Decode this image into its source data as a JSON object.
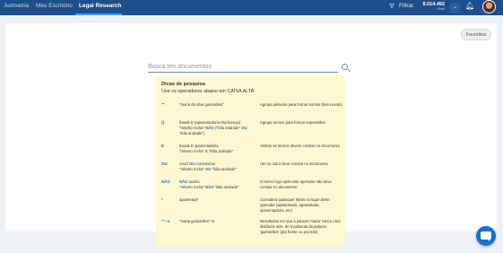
{
  "nav": {
    "items": [
      {
        "label": "Jurimetria"
      },
      {
        "label": "Meu Escritório"
      },
      {
        "label": "Legal Research"
      }
    ],
    "active_index": 2,
    "filter_label": "Filtrar",
    "credits": {
      "value": "8.014.492",
      "label": "Crwd"
    }
  },
  "favorites_label": "Favoritos",
  "search": {
    "placeholder": "Busca em documentos"
  },
  "tips": {
    "title": "Dicas de pesquisa",
    "subtitle": "Use os operadores abaixo em CAIXA ALTA:",
    "rows": [
      {
        "op": "\"\"",
        "example_lines": [
          [
            "\"maria da silva guimarães\""
          ]
        ],
        "desc": "Agrupa palavras para formar termos (texto exato)"
      },
      {
        "op": "()",
        "example_lines": [
          [
            "fraude E (aposentadoria ",
            {
              "hl": "OU"
            },
            " licença)"
          ],
          [
            "\"roberto rocha\" ",
            {
              "hl": "NÃO"
            },
            " (\"lídia andrade\" ",
            {
              "hl": "OU"
            }
          ],
          [
            "\"lidia andrade\")"
          ]
        ],
        "desc": "Agrupa termos para formar expressões"
      },
      {
        "op": "E",
        "example_lines": [
          [
            "fraude E aposentadoria"
          ],
          [
            "\"roberto rocha\" E \"lídia andrade\""
          ]
        ],
        "desc": "Ambos os termos devem constar no documento"
      },
      {
        "op": "OU",
        "example_lines": [
          [
            "covid ",
            {
              "hl": "OU"
            },
            " coronavírus"
          ],
          [
            "\"roberto rocha\" ",
            {
              "hl": "OU"
            },
            " \"lídia andrade\""
          ]
        ],
        "desc": "Um ou outro deve constar no documento"
      },
      {
        "op": "NÃO",
        "example_lines": [
          [
            "",
            {
              "hl": "NÃO"
            },
            " auxílio"
          ],
          [
            "\"roberto rocha\" ",
            {
              "hl": "NÃO"
            },
            " \"lidia andrade\""
          ]
        ],
        "desc": "O termo logo após este operador não deve constar no documento"
      },
      {
        "op": "*",
        "example_lines": [
          [
            "aposentad*"
          ]
        ],
        "desc": "Considera quaisquer letras no lugar deste operador (aposentado, aposentada, aposentadoria, etc)"
      },
      {
        "op": "\"\"~n",
        "example_lines": [
          [
            "\"maria guimarães\"~5"
          ]
        ],
        "desc": "Resultados em que a palavra 'maria' está a uma distância máx. de 5 palavras da palavra 'guimarães' (pra frente ou pra trás)"
      }
    ]
  }
}
